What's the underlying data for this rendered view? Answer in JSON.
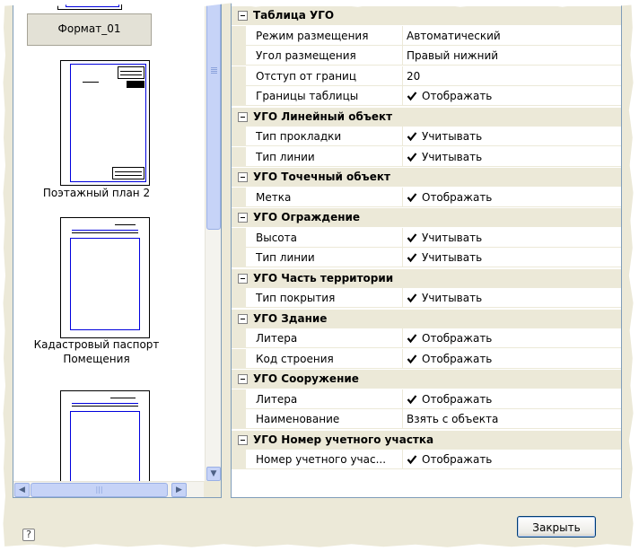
{
  "templates": [
    {
      "label": "Формат_01",
      "selected": true
    },
    {
      "label": "Поэтажный план 2",
      "selected": false
    },
    {
      "label_line1": "Кадастровый паспорт",
      "label_line2": "Помещения",
      "selected": false
    },
    {
      "label": "",
      "selected": false
    }
  ],
  "properties": [
    {
      "type": "category",
      "title": "Таблица УГО"
    },
    {
      "type": "property",
      "name": "Режим размещения",
      "value": "Автоматический",
      "checked": false
    },
    {
      "type": "property",
      "name": "Угол размещения",
      "value": "Правый нижний",
      "checked": false
    },
    {
      "type": "property",
      "name": "Отступ от границ",
      "value": "20",
      "checked": false
    },
    {
      "type": "property",
      "name": "Границы таблицы",
      "value": "Отображать",
      "checked": true
    },
    {
      "type": "category",
      "title": "УГО Линейный объект"
    },
    {
      "type": "property",
      "name": "Тип прокладки",
      "value": "Учитывать",
      "checked": true
    },
    {
      "type": "property",
      "name": "Тип линии",
      "value": "Учитывать",
      "checked": true
    },
    {
      "type": "category",
      "title": "УГО Точечный объект"
    },
    {
      "type": "property",
      "name": "Метка",
      "value": "Отображать",
      "checked": true
    },
    {
      "type": "category",
      "title": "УГО Ограждение"
    },
    {
      "type": "property",
      "name": "Высота",
      "value": "Учитывать",
      "checked": true
    },
    {
      "type": "property",
      "name": "Тип линии",
      "value": "Учитывать",
      "checked": true
    },
    {
      "type": "category",
      "title": "УГО Часть территории"
    },
    {
      "type": "property",
      "name": "Тип покрытия",
      "value": "Учитывать",
      "checked": true
    },
    {
      "type": "category",
      "title": "УГО Здание"
    },
    {
      "type": "property",
      "name": "Литера",
      "value": "Отображать",
      "checked": true
    },
    {
      "type": "property",
      "name": "Код строения",
      "value": "Отображать",
      "checked": true
    },
    {
      "type": "category",
      "title": "УГО Сооружение"
    },
    {
      "type": "property",
      "name": "Литера",
      "value": "Отображать",
      "checked": true
    },
    {
      "type": "property",
      "name": "Наименование",
      "value": "Взять с объекта",
      "checked": false
    },
    {
      "type": "category",
      "title": "УГО Номер учетного участка"
    },
    {
      "type": "property",
      "name": "Номер учетного учас...",
      "value": "Отображать",
      "checked": true
    }
  ],
  "footer": {
    "help_glyph": "?",
    "close_label": "Закрыть"
  },
  "colors": {
    "dialog_bg": "#ece9d8",
    "frame_blue": "#0000dd",
    "border": "#7f9db9"
  }
}
